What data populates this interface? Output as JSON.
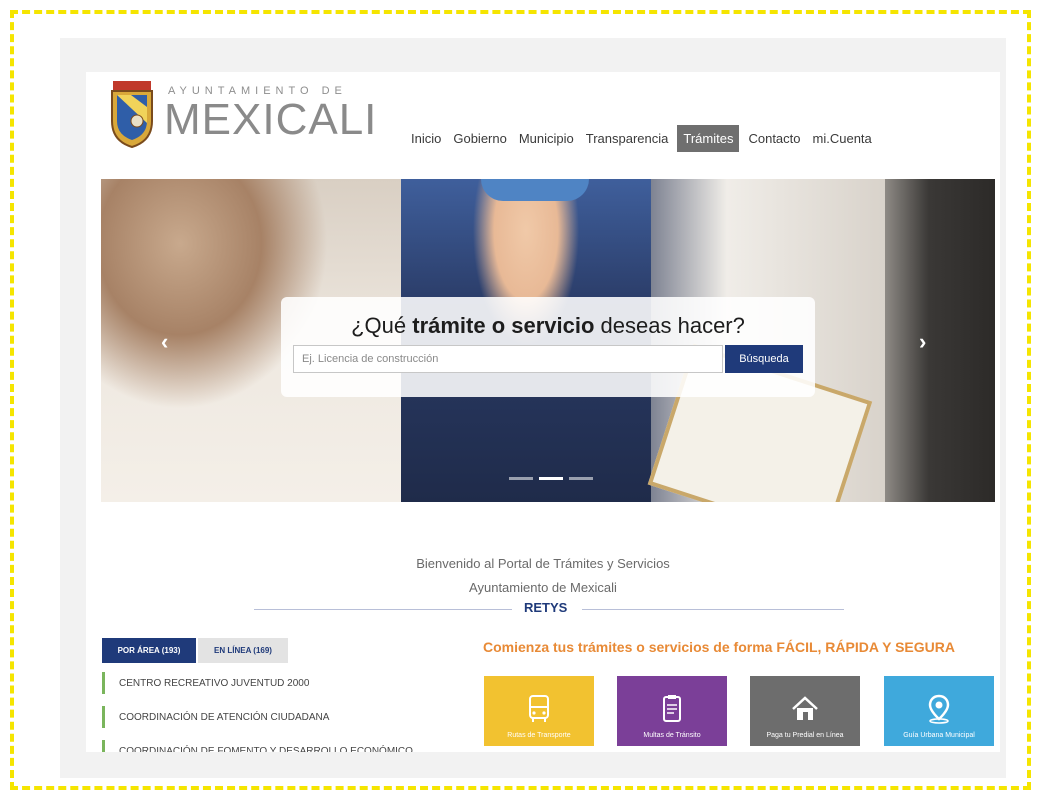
{
  "brand": {
    "sub": "AYUNTAMIENTO DE",
    "main": "MEXICALI"
  },
  "nav": {
    "items": [
      {
        "label": "Inicio",
        "active": false
      },
      {
        "label": "Gobierno",
        "active": false
      },
      {
        "label": "Municipio",
        "active": false
      },
      {
        "label": "Transparencia",
        "active": false
      },
      {
        "label": "Trámites",
        "active": true
      },
      {
        "label": "Contacto",
        "active": false
      },
      {
        "label": "mi.Cuenta",
        "active": false
      }
    ]
  },
  "hero": {
    "question_lead": "¿Qué ",
    "question_bold": "trámite o servicio",
    "question_tail": " deseas hacer?",
    "search_placeholder": "Ej. Licencia de construcción",
    "search_button": "Búsqueda",
    "prev_icon": "‹",
    "next_icon": "›",
    "slide_count": 3,
    "active_slide": 2
  },
  "welcome": {
    "line1": "Bienvenido al Portal de Trámites y Servicios",
    "line2": "Ayuntamiento de Mexicali",
    "retys": "RETYS"
  },
  "tabs": {
    "area": "POR ÁREA (193)",
    "online": "EN LÍNEA (169)"
  },
  "areas": [
    "CENTRO RECREATIVO JUVENTUD 2000",
    "COORDINACIÓN DE ATENCIÓN CIUDADANA",
    "COORDINACIÓN DE FOMENTO Y DESARROLLO ECONÓMICO"
  ],
  "promo": {
    "title": "Comienza tus trámites o servicios de forma FÁCIL, RÁPIDA Y SEGURA"
  },
  "services": [
    {
      "label": "Rutas de Transporte",
      "color": "#f2c230",
      "icon": "bus-icon"
    },
    {
      "label": "Multas de Tránsito",
      "color": "#7b3f98",
      "icon": "ticket-icon"
    },
    {
      "label": "Paga tu Predial en Línea",
      "color": "#6d6d6d",
      "icon": "home-icon"
    },
    {
      "label": "Guía Urbana Municipal",
      "color": "#3fa9dc",
      "icon": "map-pin-icon"
    }
  ]
}
